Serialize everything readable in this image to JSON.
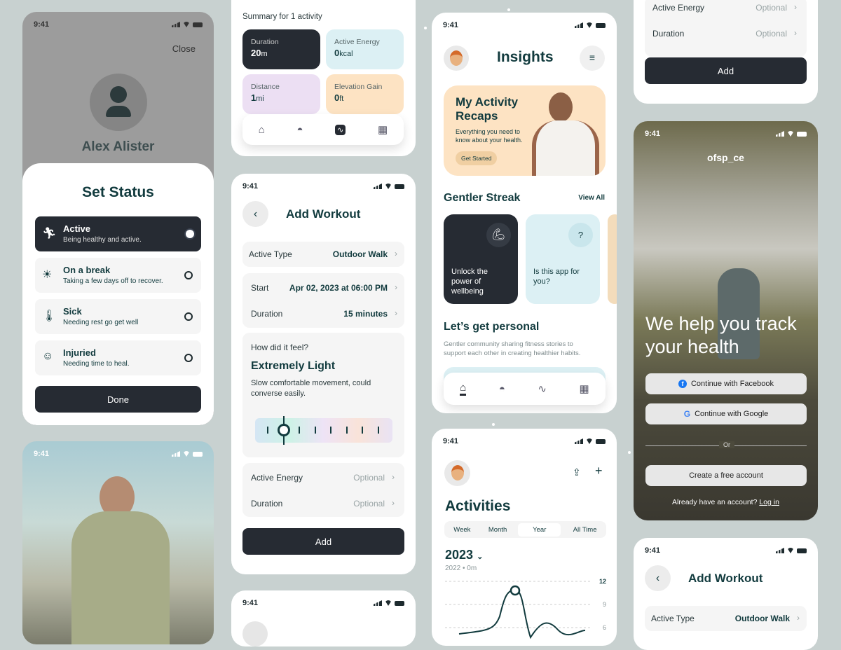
{
  "status_time": "9:41",
  "profile_sheet": {
    "close_label": "Close",
    "name": "Alex Alister",
    "title": "Set Status",
    "statuses": [
      {
        "label": "Active",
        "desc": "Being healthy and active.",
        "icon": "running-icon",
        "selected": true
      },
      {
        "label": "On a break",
        "desc": "Taking a few days off to recover.",
        "icon": "sunset-icon",
        "selected": false
      },
      {
        "label": "Sick",
        "desc": "Needing rest go get well",
        "icon": "thermometer-icon",
        "selected": false
      },
      {
        "label": "Injuried",
        "desc": "Needing time to heal.",
        "icon": "head-bandage-icon",
        "selected": false
      }
    ],
    "done_label": "Done"
  },
  "summary": {
    "heading": "Summary for 1 activity",
    "tiles": [
      {
        "label": "Duration",
        "value": "20",
        "unit": "m"
      },
      {
        "label": "Active Energy",
        "value": "0",
        "unit": "kcal"
      },
      {
        "label": "Distance",
        "value": "1",
        "unit": "mi"
      },
      {
        "label": "Elevation Gain",
        "value": "0",
        "unit": "ft"
      }
    ],
    "nav": [
      "home-icon",
      "shoe-icon",
      "chart-icon",
      "grid-icon"
    ],
    "active_nav": "chart-icon"
  },
  "add_workout": {
    "title": "Add Workout",
    "active_type_label": "Active Type",
    "active_type_value": "Outdoor Walk",
    "start_label": "Start",
    "start_value": "Apr 02, 2023 at 06:00 PM",
    "duration_label": "Duration",
    "duration_value": "15 minutes",
    "feel_question": "How did it feel?",
    "feel_level": "Extremely Light",
    "feel_desc": "Slow comfortable movement, could converse easily.",
    "feel_slider_position": 1,
    "feel_slider_steps": 8,
    "energy_label": "Active Energy",
    "optional": "Optional",
    "duration2_label": "Duration",
    "add_label": "Add"
  },
  "insights": {
    "title": "Insights",
    "recap_title": "My Activity Recaps",
    "recap_desc": "Everything you need to know about your health.",
    "recap_button": "Get Started",
    "streak_title": "Gentler Streak",
    "view_all": "View All",
    "streak_cards": [
      {
        "text": "Unlock the power of wellbeing",
        "icon": "flexed-arm-icon"
      },
      {
        "text": "Is this app for you?",
        "icon": "question-bubble-icon"
      }
    ],
    "personal_title": "Let’s get personal",
    "personal_desc": "Gentler community sharing fitness stories to support each other in creating healthier habits.",
    "nav": [
      "home-icon",
      "shoe-icon",
      "chart-icon",
      "grid-icon"
    ],
    "active_nav": "home-icon"
  },
  "activities": {
    "title": "Activities",
    "tabs": [
      "Week",
      "Month",
      "Year",
      "All Time"
    ],
    "active_tab": "Year",
    "year": "2023",
    "prev": "2022 • 0m",
    "y_ticks": [
      "12",
      "9",
      "6"
    ]
  },
  "login": {
    "logo": "ofsp_ce",
    "headline": "We help you track your health",
    "facebook": "Continue with Facebook",
    "google": "Continue with Google",
    "or": "Or",
    "create": "Create a free account",
    "have_account": "Already have an account?",
    "login": "Log in"
  },
  "colors": {
    "dark": "#262b33",
    "teal_text": "#123b3e",
    "peach": "#fde3c3",
    "light_blue": "#dcf0f4",
    "lavender": "#ecdff3"
  }
}
